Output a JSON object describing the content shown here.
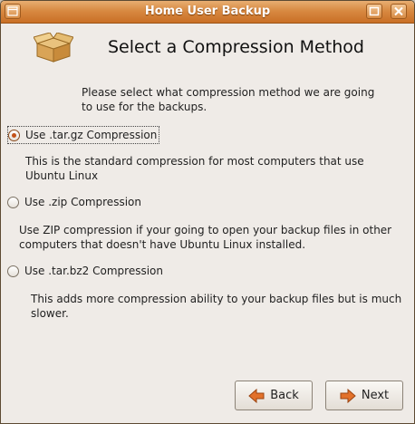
{
  "window": {
    "title": "Home User Backup"
  },
  "page": {
    "heading": "Select a Compression Method",
    "intro": "Please select what compression method we are going to use for the backups."
  },
  "options": [
    {
      "label": "Use .tar.gz Compression",
      "checked": true,
      "description": "This is the standard compression for most computers that use Ubuntu Linux"
    },
    {
      "label": "Use .zip Compression",
      "checked": false,
      "description": "Use ZIP compression if your going to open your backup files in other computers that doesn't have Ubuntu Linux installed."
    },
    {
      "label": "Use .tar.bz2 Compression",
      "checked": false,
      "description": "This adds more compression ability to your backup files but is much slower."
    }
  ],
  "buttons": {
    "back": "Back",
    "next": "Next"
  },
  "colors": {
    "titlebar": "#d88a42",
    "arrow": "#e2712a",
    "radio_dot": "#c4521a"
  },
  "icons": {
    "header": "package-box-icon",
    "back": "arrow-left-icon",
    "next": "arrow-right-icon"
  }
}
